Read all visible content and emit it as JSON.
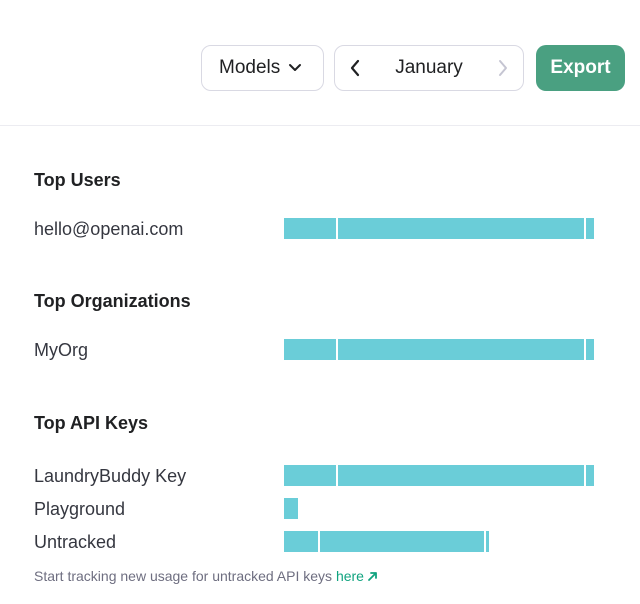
{
  "toolbar": {
    "models_label": "Models",
    "month_label": "January",
    "export_label": "Export"
  },
  "sections": {
    "users": {
      "title": "Top Users",
      "rows": [
        {
          "label": "hello@openai.com",
          "segments": [
            52,
            246,
            8
          ]
        }
      ]
    },
    "orgs": {
      "title": "Top Organizations",
      "rows": [
        {
          "label": "MyOrg",
          "segments": [
            52,
            246,
            8
          ]
        }
      ]
    },
    "keys": {
      "title": "Top API Keys",
      "rows": [
        {
          "label": "LaundryBuddy Key",
          "segments": [
            52,
            246,
            8
          ]
        },
        {
          "label": "Playground",
          "segments": [
            14
          ]
        },
        {
          "label": "Untracked",
          "segments": [
            34,
            164,
            3
          ]
        }
      ]
    }
  },
  "footnote": {
    "text": "Start tracking new usage for untracked API keys",
    "link": "here"
  },
  "colors": {
    "bar": "#6acdd8",
    "accent": "#4aa081",
    "link": "#10a37f"
  }
}
